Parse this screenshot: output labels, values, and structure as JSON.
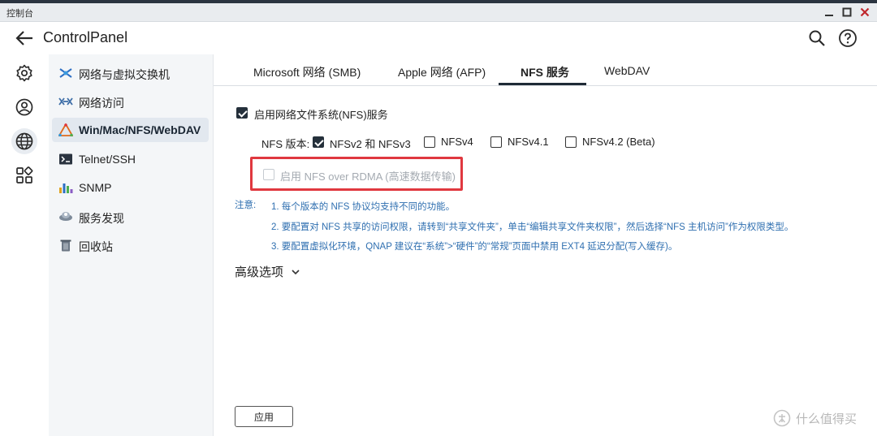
{
  "window": {
    "title": "控制台"
  },
  "header": {
    "title": "ControlPanel"
  },
  "sidebar": {
    "items": [
      {
        "label": "网络与虚拟交换机"
      },
      {
        "label": "网络访问"
      },
      {
        "label": "Win/Mac/NFS/WebDAV"
      },
      {
        "label": "Telnet/SSH"
      },
      {
        "label": "SNMP"
      },
      {
        "label": "服务发现"
      },
      {
        "label": "回收站"
      }
    ]
  },
  "tabs": [
    {
      "label": "Microsoft 网络 (SMB)"
    },
    {
      "label": "Apple 网络 (AFP)"
    },
    {
      "label": "NFS 服务"
    },
    {
      "label": "WebDAV"
    }
  ],
  "nfs": {
    "enable_label": "启用网络文件系统(NFS)服务",
    "enable_checked": true,
    "version_label": "NFS 版本:",
    "versions": [
      {
        "label": "NFSv2 和 NFSv3",
        "checked": true
      },
      {
        "label": "NFSv4",
        "checked": false
      },
      {
        "label": "NFSv4.1",
        "checked": false
      },
      {
        "label": "NFSv4.2 (Beta)",
        "checked": false
      }
    ],
    "rdma_label": "启用 NFS over RDMA (高速数据传输)",
    "rdma_checked": false,
    "note_label": "注意:",
    "notes": [
      "1. 每个版本的 NFS 协议均支持不同的功能。",
      "2. 要配置对 NFS 共享的访问权限，请转到“共享文件夹”，单击“编辑共享文件夹权限”，然后选择“NFS 主机访问”作为权限类型。",
      "3. 要配置虚拟化环境，QNAP 建议在“系统”>“硬件”的“常规”页面中禁用 EXT4 延迟分配(写入缓存)。"
    ],
    "advanced_label": "高级选项"
  },
  "footer": {
    "apply_label": "应用"
  },
  "watermark": {
    "text": "什么值得买"
  },
  "colors": {
    "accent": "#1f2a36",
    "note": "#2f6fb0",
    "highlight": "#e0383f"
  }
}
